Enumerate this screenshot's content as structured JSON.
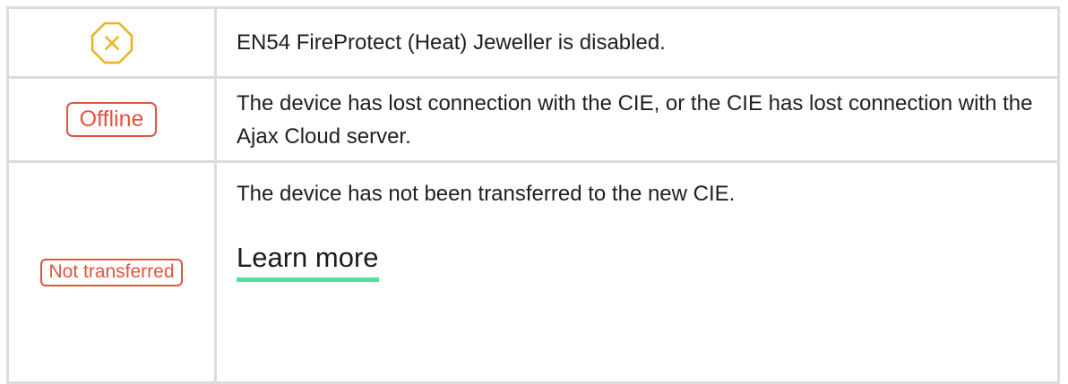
{
  "rows": [
    {
      "icon": "disabled-x-octagon-icon",
      "icon_color": "#e8b520",
      "text": "EN54 FireProtect (Heat) Jeweller is disabled."
    },
    {
      "badge": "Offline",
      "badge_color": "#e4533f",
      "text": "The device has lost connection with the CIE, or the CIE has lost connection with the Ajax Cloud server."
    },
    {
      "badge": "Not transferred",
      "badge_color": "#e4533f",
      "text": "The device has not been transferred to the new CIE.",
      "link": "Learn more",
      "link_underline_color": "#54dda1"
    }
  ]
}
